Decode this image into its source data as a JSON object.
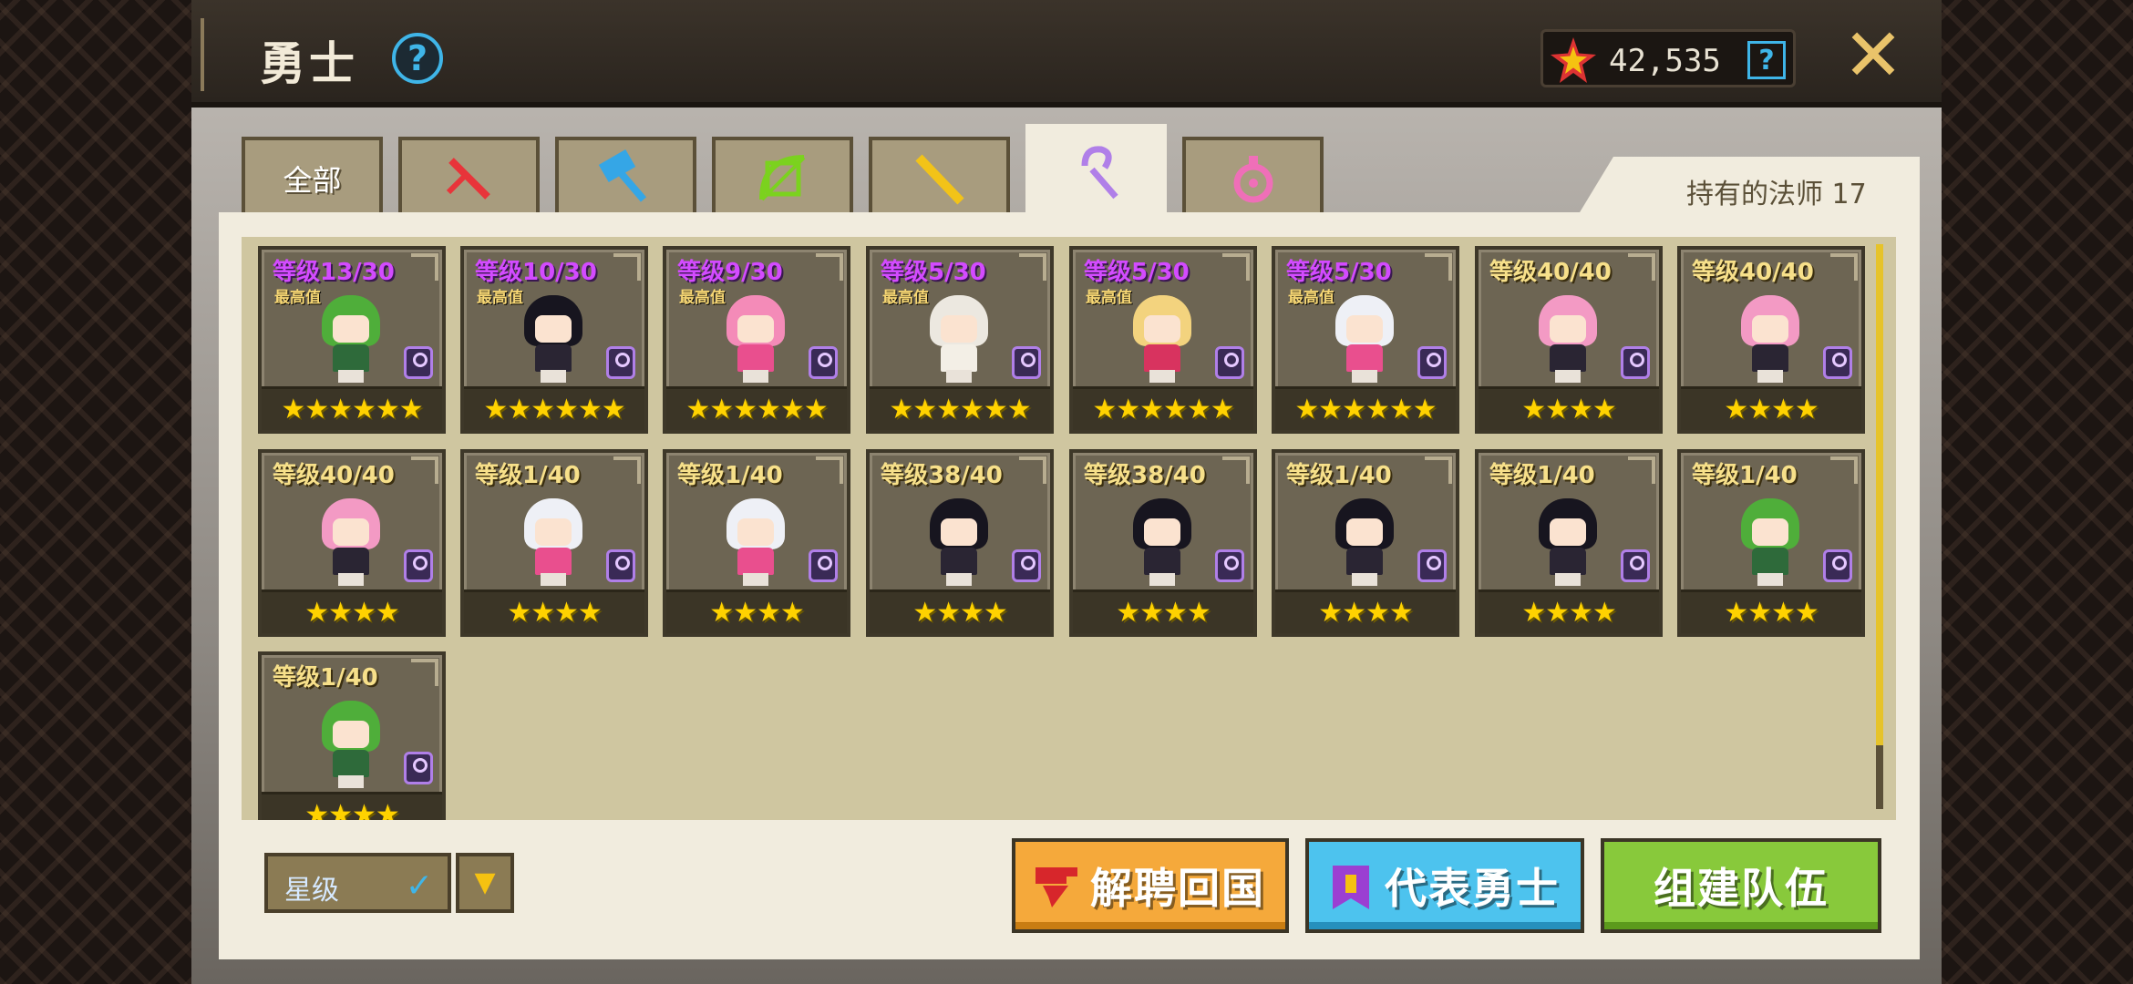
{
  "header": {
    "title": "勇士",
    "help_icon": "?",
    "currency_value": "42,535",
    "currency_help": "?",
    "close_icon": "✕"
  },
  "tabs": [
    {
      "label": "全部",
      "icon": "all",
      "active": false
    },
    {
      "label": "",
      "icon": "sword-icon",
      "color": "#e8343a",
      "active": false
    },
    {
      "label": "",
      "icon": "hammer-icon",
      "color": "#35a6e6",
      "active": false
    },
    {
      "label": "",
      "icon": "bow-icon",
      "color": "#7bd21e",
      "active": false
    },
    {
      "label": "",
      "icon": "gun-icon",
      "color": "#f2c318",
      "active": false
    },
    {
      "label": "",
      "icon": "staff-icon",
      "color": "#b07fe8",
      "active": true
    },
    {
      "label": "",
      "icon": "support-icon",
      "color": "#ef6fb8",
      "active": false
    }
  ],
  "owned_label": "持有的法师 17",
  "heroes": [
    {
      "level": "等级13/30",
      "max": "最高值",
      "stars": "★★★★★★",
      "hair": "#4fae3a",
      "outfit": "#2e6a3a"
    },
    {
      "level": "等级10/30",
      "max": "最高值",
      "stars": "★★★★★★",
      "hair": "#17151f",
      "outfit": "#2a2533"
    },
    {
      "level": "等级9/30",
      "max": "最高值",
      "stars": "★★★★★★",
      "hair": "#f48bb8",
      "outfit": "#e94f8e"
    },
    {
      "level": "等级5/30",
      "max": "最高值",
      "stars": "★★★★★★",
      "hair": "#ece8e0",
      "outfit": "#f3efe6"
    },
    {
      "level": "等级5/30",
      "max": "最高值",
      "stars": "★★★★★★",
      "hair": "#f3d37e",
      "outfit": "#d8335f"
    },
    {
      "level": "等级5/30",
      "max": "最高值",
      "stars": "★★★★★★",
      "hair": "#eef0f6",
      "outfit": "#e94f8e"
    },
    {
      "level": "等级40/40",
      "max": "",
      "stars": "★★★★",
      "hair": "#f39ac4",
      "outfit": "#2a2533"
    },
    {
      "level": "等级40/40",
      "max": "",
      "stars": "★★★★",
      "hair": "#f39ac4",
      "outfit": "#2a2533"
    },
    {
      "level": "等级40/40",
      "max": "",
      "stars": "★★★★",
      "hair": "#f39ac4",
      "outfit": "#2a2533"
    },
    {
      "level": "等级1/40",
      "max": "",
      "stars": "★★★★",
      "hair": "#eef0f6",
      "outfit": "#e94f8e"
    },
    {
      "level": "等级1/40",
      "max": "",
      "stars": "★★★★",
      "hair": "#eef0f6",
      "outfit": "#e94f8e"
    },
    {
      "level": "等级38/40",
      "max": "",
      "stars": "★★★★",
      "hair": "#17151f",
      "outfit": "#2a2533"
    },
    {
      "level": "等级38/40",
      "max": "",
      "stars": "★★★★",
      "hair": "#17151f",
      "outfit": "#2a2533"
    },
    {
      "level": "等级1/40",
      "max": "",
      "stars": "★★★★",
      "hair": "#17151f",
      "outfit": "#2a2533"
    },
    {
      "level": "等级1/40",
      "max": "",
      "stars": "★★★★",
      "hair": "#17151f",
      "outfit": "#2a2533"
    },
    {
      "level": "等级1/40",
      "max": "",
      "stars": "★★★★",
      "hair": "#4fae3a",
      "outfit": "#2e6a3a"
    },
    {
      "level": "等级1/40",
      "max": "",
      "stars": "★★★★",
      "hair": "#4fae3a",
      "outfit": "#2e6a3a"
    }
  ],
  "sort": {
    "label": "星级",
    "check": "✓",
    "dropdown": "▼"
  },
  "buttons": {
    "dismiss": "解聘回国",
    "representative": "代表勇士",
    "build_team": "组建队伍"
  }
}
